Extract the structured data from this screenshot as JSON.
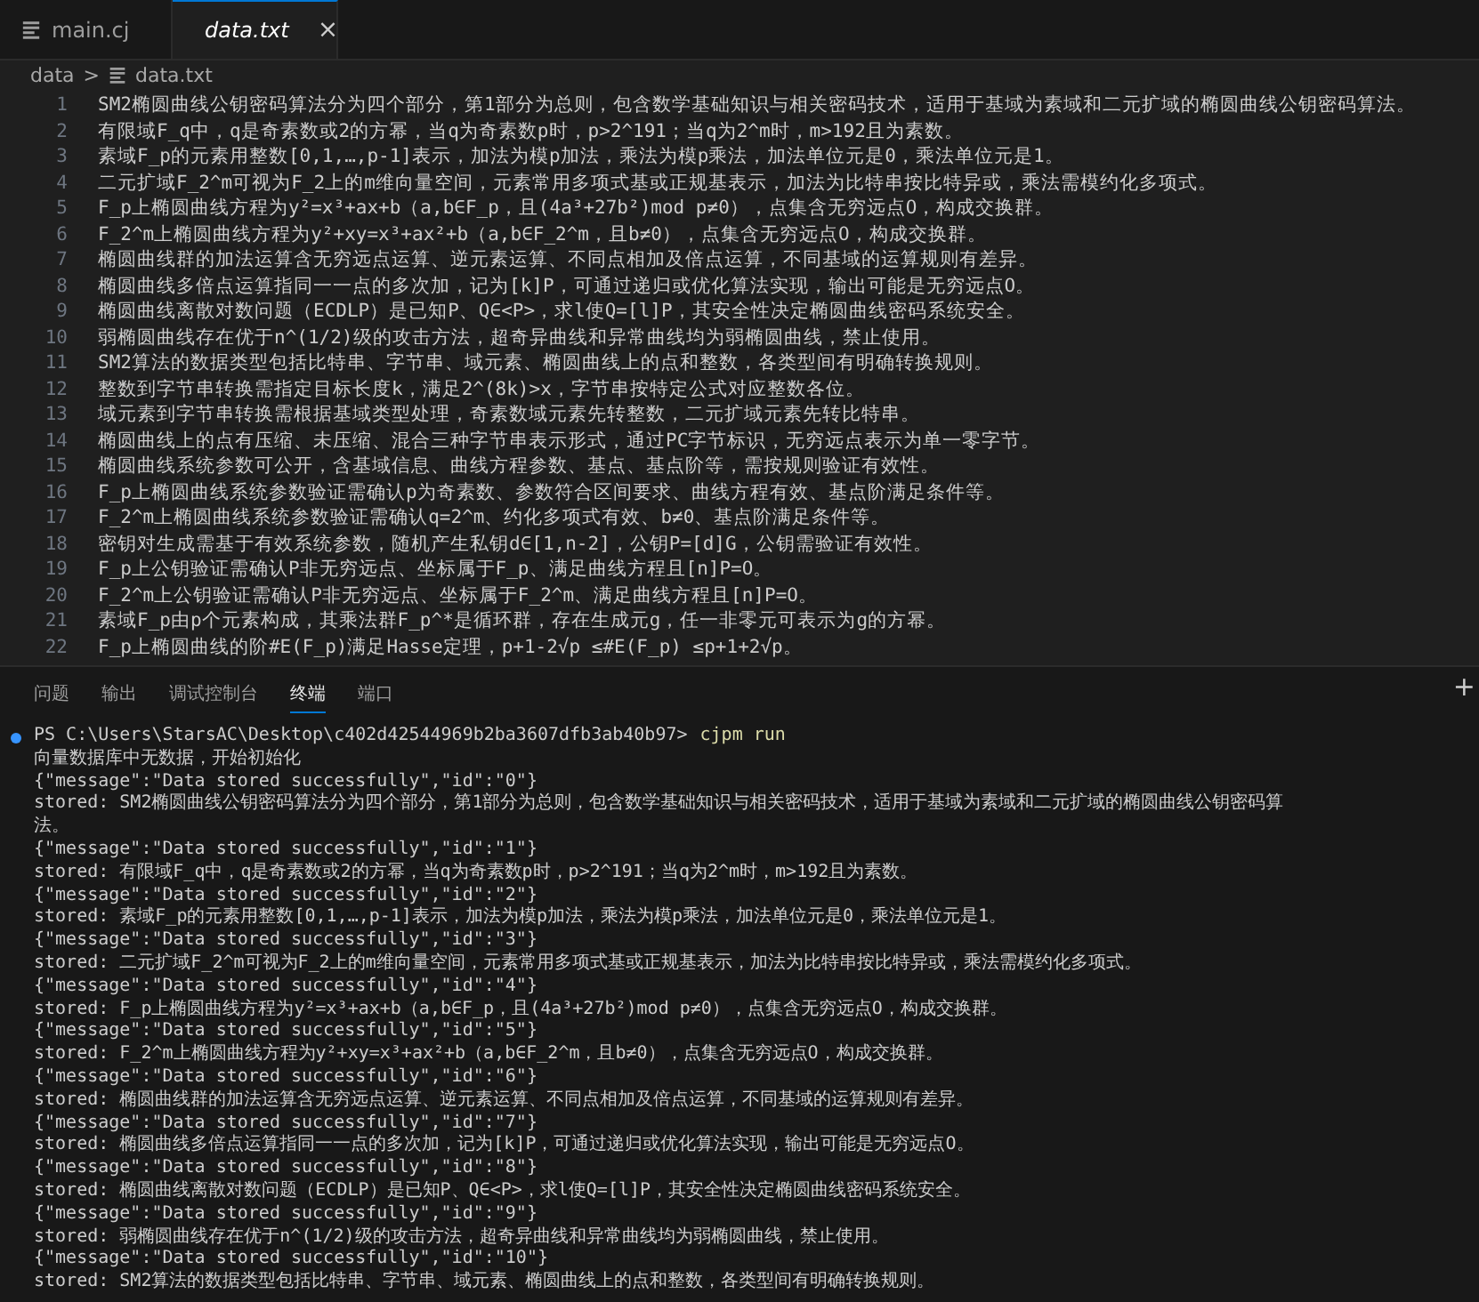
{
  "tabs": [
    {
      "label": "main.cj",
      "selected": false,
      "preview": false
    },
    {
      "label": "data.txt",
      "selected": true,
      "preview": true,
      "close": "×"
    }
  ],
  "breadcrumb": {
    "folder": "data",
    "separator": ">",
    "file": "data.txt"
  },
  "editor": {
    "lines": [
      {
        "number": "1",
        "text": "SM2椭圆曲线公钥密码算法分为四个部分，第1部分为总则，包含数学基础知识与相关密码技术，适用于基域为素域和二元扩域的椭圆曲线公钥密码算法。"
      },
      {
        "number": "2",
        "text": "有限域F_q中，q是奇素数或2的方幂，当q为奇素数p时，p>2^191；当q为2^m时，m>192且为素数。"
      },
      {
        "number": "3",
        "text": "素域F_p的元素用整数[0,1,…,p-1]表示，加法为模p加法，乘法为模p乘法，加法单位元是0，乘法单位元是1。"
      },
      {
        "number": "4",
        "text": "二元扩域F_2^m可视为F_2上的m维向量空间，元素常用多项式基或正规基表示，加法为比特串按比特异或，乘法需模约化多项式。"
      },
      {
        "number": "5",
        "text": "F_p上椭圆曲线方程为y²=x³+ax+b（a,b∈F_p，且(4a³+27b²)mod p≠0），点集含无穷远点O，构成交换群。"
      },
      {
        "number": "6",
        "text": "F_2^m上椭圆曲线方程为y²+xy=x³+ax²+b（a,b∈F_2^m，且b≠0），点集含无穷远点O，构成交换群。"
      },
      {
        "number": "7",
        "text": "椭圆曲线群的加法运算含无穷远点运算、逆元素运算、不同点相加及倍点运算，不同基域的运算规则有差异。"
      },
      {
        "number": "8",
        "text": "椭圆曲线多倍点运算指同一一点的多次加，记为[k]P，可通过递归或优化算法实现，输出可能是无穷远点O。"
      },
      {
        "number": "9",
        "text": "椭圆曲线离散对数问题（ECDLP）是已知P、Q∈<P>，求l使Q=[l]P，其安全性决定椭圆曲线密码系统安全。"
      },
      {
        "number": "10",
        "text": "弱椭圆曲线存在优于n^(1/2)级的攻击方法，超奇异曲线和异常曲线均为弱椭圆曲线，禁止使用。"
      },
      {
        "number": "11",
        "text": "SM2算法的数据类型包括比特串、字节串、域元素、椭圆曲线上的点和整数，各类型间有明确转换规则。"
      },
      {
        "number": "12",
        "text": "整数到字节串转换需指定目标长度k，满足2^(8k)>x，字节串按特定公式对应整数各位。"
      },
      {
        "number": "13",
        "text": "域元素到字节串转换需根据基域类型处理，奇素数域元素先转整数，二元扩域元素先转比特串。"
      },
      {
        "number": "14",
        "text": "椭圆曲线上的点有压缩、未压缩、混合三种字节串表示形式，通过PC字节标识，无穷远点表示为单一零字节。"
      },
      {
        "number": "15",
        "text": "椭圆曲线系统参数可公开，含基域信息、曲线方程参数、基点、基点阶等，需按规则验证有效性。"
      },
      {
        "number": "16",
        "text": "F_p上椭圆曲线系统参数验证需确认p为奇素数、参数符合区间要求、曲线方程有效、基点阶满足条件等。"
      },
      {
        "number": "17",
        "text": "F_2^m上椭圆曲线系统参数验证需确认q=2^m、约化多项式有效、b≠0、基点阶满足条件等。"
      },
      {
        "number": "18",
        "text": "密钥对生成需基于有效系统参数，随机产生私钥d∈[1,n-2]，公钥P=[d]G，公钥需验证有效性。"
      },
      {
        "number": "19",
        "text": "F_p上公钥验证需确认P非无穷远点、坐标属于F_p、满足曲线方程且[n]P=O。"
      },
      {
        "number": "20",
        "text": "F_2^m上公钥验证需确认P非无穷远点、坐标属于F_2^m、满足曲线方程且[n]P=O。"
      },
      {
        "number": "21",
        "text": "素域F_p由p个元素构成，其乘法群F_p^*是循环群，存在生成元g，任一非零元可表示为g的方幂。"
      },
      {
        "number": "22",
        "text": "F_p上椭圆曲线的阶#E(F_p)满足Hasse定理，p+1-2√p ≤#E(F_p) ≤p+1+2√p。"
      }
    ]
  },
  "panel": {
    "tabs": [
      {
        "label": "问题",
        "selected": false
      },
      {
        "label": "输出",
        "selected": false
      },
      {
        "label": "调试控制台",
        "selected": false
      },
      {
        "label": "终端",
        "selected": true
      },
      {
        "label": "端口",
        "selected": false
      }
    ],
    "add": "+"
  },
  "terminal": {
    "prompt": "PS C:\\Users\\StarsAC\\Desktop\\c402d42544969b2ba3607dfb3ab40b97>",
    "command": "cjpm run",
    "lines": [
      "向量数据库中无数据，开始初始化",
      "{\"message\":\"Data stored successfully\",\"id\":\"0\"}",
      "stored: SM2椭圆曲线公钥密码算法分为四个部分，第1部分为总则，包含数学基础知识与相关密码技术，适用于基域为素域和二元扩域的椭圆曲线公钥密码算",
      "法。",
      "{\"message\":\"Data stored successfully\",\"id\":\"1\"}",
      "stored: 有限域F_q中，q是奇素数或2的方幂，当q为奇素数p时，p>2^191；当q为2^m时，m>192且为素数。",
      "{\"message\":\"Data stored successfully\",\"id\":\"2\"}",
      "stored: 素域F_p的元素用整数[0,1,…,p-1]表示，加法为模p加法，乘法为模p乘法，加法单位元是0，乘法单位元是1。",
      "{\"message\":\"Data stored successfully\",\"id\":\"3\"}",
      "stored: 二元扩域F_2^m可视为F_2上的m维向量空间，元素常用多项式基或正规基表示，加法为比特串按比特异或，乘法需模约化多项式。",
      "{\"message\":\"Data stored successfully\",\"id\":\"4\"}",
      "stored: F_p上椭圆曲线方程为y²=x³+ax+b（a,b∈F_p，且(4a³+27b²)mod p≠0），点集含无穷远点O，构成交换群。",
      "{\"message\":\"Data stored successfully\",\"id\":\"5\"}",
      "stored: F_2^m上椭圆曲线方程为y²+xy=x³+ax²+b（a,b∈F_2^m，且b≠0），点集含无穷远点O，构成交换群。",
      "{\"message\":\"Data stored successfully\",\"id\":\"6\"}",
      "stored: 椭圆曲线群的加法运算含无穷远点运算、逆元素运算、不同点相加及倍点运算，不同基域的运算规则有差异。",
      "{\"message\":\"Data stored successfully\",\"id\":\"7\"}",
      "stored: 椭圆曲线多倍点运算指同一一点的多次加，记为[k]P，可通过递归或优化算法实现，输出可能是无穷远点O。",
      "{\"message\":\"Data stored successfully\",\"id\":\"8\"}",
      "stored: 椭圆曲线离散对数问题（ECDLP）是已知P、Q∈<P>，求l使Q=[l]P，其安全性决定椭圆曲线密码系统安全。",
      "{\"message\":\"Data stored successfully\",\"id\":\"9\"}",
      "stored: 弱椭圆曲线存在优于n^(1/2)级的攻击方法，超奇异曲线和异常曲线均为弱椭圆曲线，禁止使用。",
      "{\"message\":\"Data stored successfully\",\"id\":\"10\"}",
      "stored: SM2算法的数据类型包括比特串、字节串、域元素、椭圆曲线上的点和整数，各类型间有明确转换规则。"
    ]
  }
}
